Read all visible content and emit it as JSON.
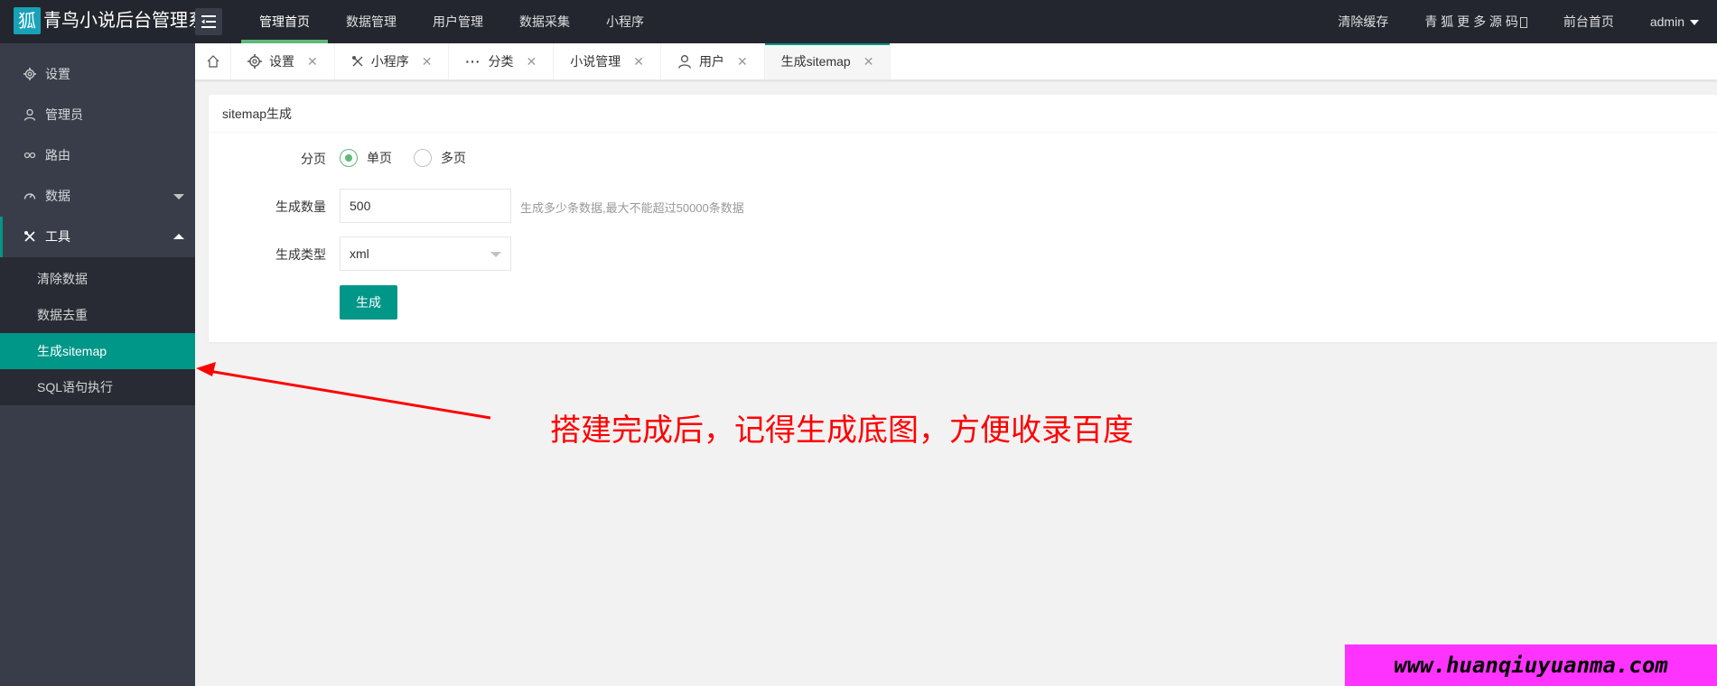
{
  "header": {
    "logo_glyph": "狐",
    "app_title": "青鸟小说后台管理系",
    "nav": [
      "管理首页",
      "数据管理",
      "用户管理",
      "数据采集",
      "小程序"
    ],
    "right": [
      "清除缓存",
      "青 狐 更 多 源 码",
      "前台首页",
      "admin"
    ]
  },
  "sidebar": {
    "items": [
      {
        "label": "设置",
        "icon": "gear-icon"
      },
      {
        "label": "管理员",
        "icon": "user-icon"
      },
      {
        "label": "路由",
        "icon": "link-icon"
      },
      {
        "label": "数据",
        "icon": "dashboard-icon"
      },
      {
        "label": "工具",
        "icon": "tools-icon"
      }
    ],
    "submenu": [
      "清除数据",
      "数据去重",
      "生成sitemap",
      "SQL语句执行"
    ]
  },
  "tabs": [
    {
      "label": "设置",
      "icon": "gear-icon"
    },
    {
      "label": "小程序",
      "icon": "tools-icon"
    },
    {
      "label": "分类",
      "icon": "more-icon"
    },
    {
      "label": "小说管理",
      "icon": ""
    },
    {
      "label": "用户",
      "icon": "user-icon"
    },
    {
      "label": "生成sitemap",
      "icon": ""
    }
  ],
  "form": {
    "title": "sitemap生成",
    "paging_label": "分页",
    "paging_options": [
      "单页",
      "多页"
    ],
    "count_label": "生成数量",
    "count_value": "500",
    "count_hint": "生成多少条数据,最大不能超过50000条数据",
    "type_label": "生成类型",
    "type_value": "xml",
    "submit_label": "生成"
  },
  "annotation": {
    "text": "搭建完成后，记得生成底图，方便收录百度",
    "color": "#ff0000"
  },
  "watermark": "www.huanqiuyuanma.com",
  "colors": {
    "header_bg": "#23262e",
    "sidebar_bg": "#393d49",
    "accent": "#009688",
    "radio_green": "#5fb878"
  }
}
